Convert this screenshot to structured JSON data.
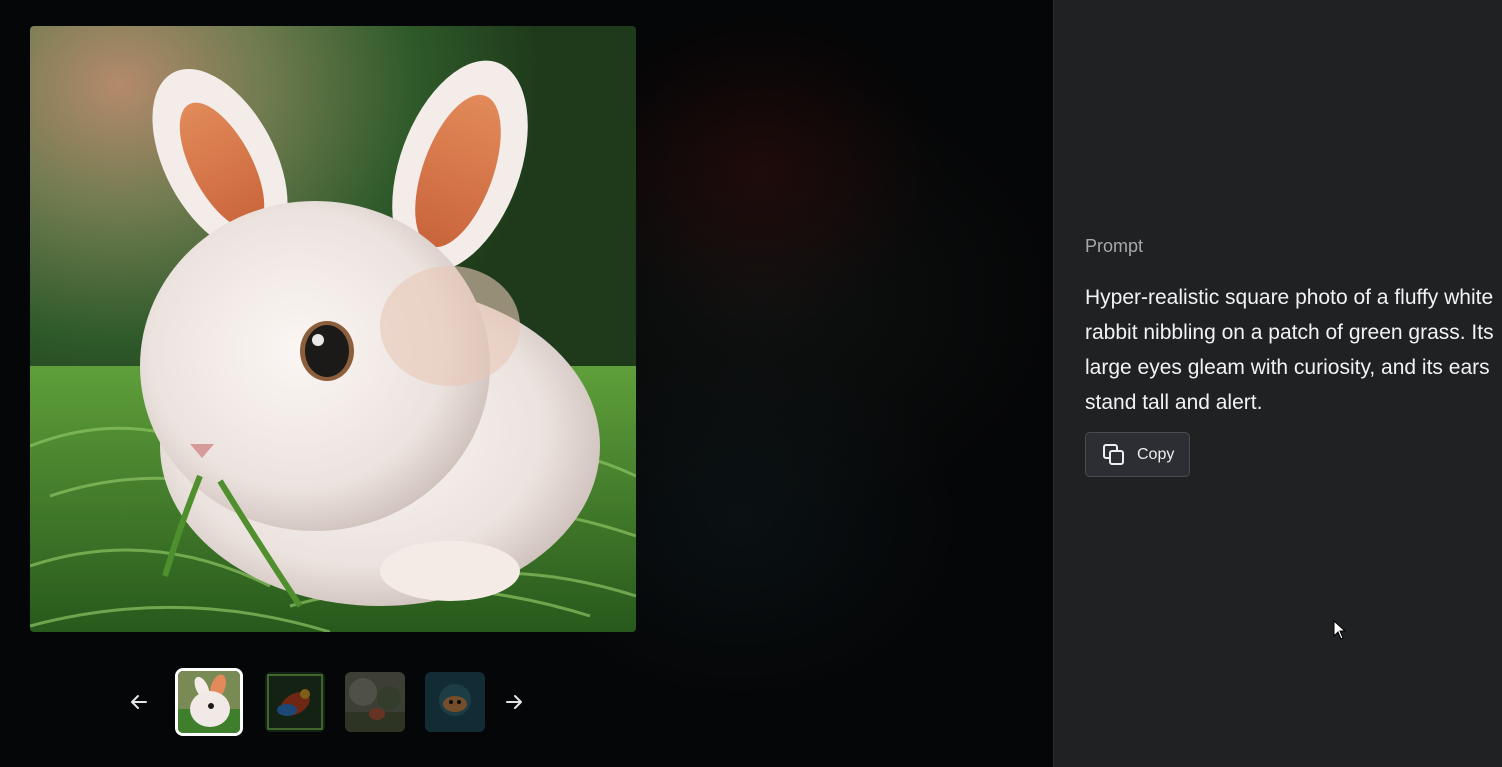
{
  "gallery": {
    "main_image_alt": "rabbit-image",
    "thumbnails": [
      {
        "name": "thumb-rabbit",
        "active": true
      },
      {
        "name": "thumb-parrot",
        "active": false
      },
      {
        "name": "thumb-forest",
        "active": false
      },
      {
        "name": "thumb-ocean",
        "active": false
      }
    ],
    "prev_icon": "arrow-left-icon",
    "next_icon": "arrow-right-icon"
  },
  "panel": {
    "label": "Prompt",
    "text": "Hyper-realistic square photo of a fluffy white rabbit nibbling on a patch of green grass. Its large eyes gleam with curiosity, and its ears stand tall and alert.",
    "copy_label": "Copy",
    "copy_icon": "copy-icon"
  },
  "colors": {
    "panel_bg": "#202123",
    "viewer_bg": "#050607",
    "text_primary": "#f2f2f3",
    "text_secondary": "#a7a8ad",
    "button_bg": "#2d2e33"
  }
}
